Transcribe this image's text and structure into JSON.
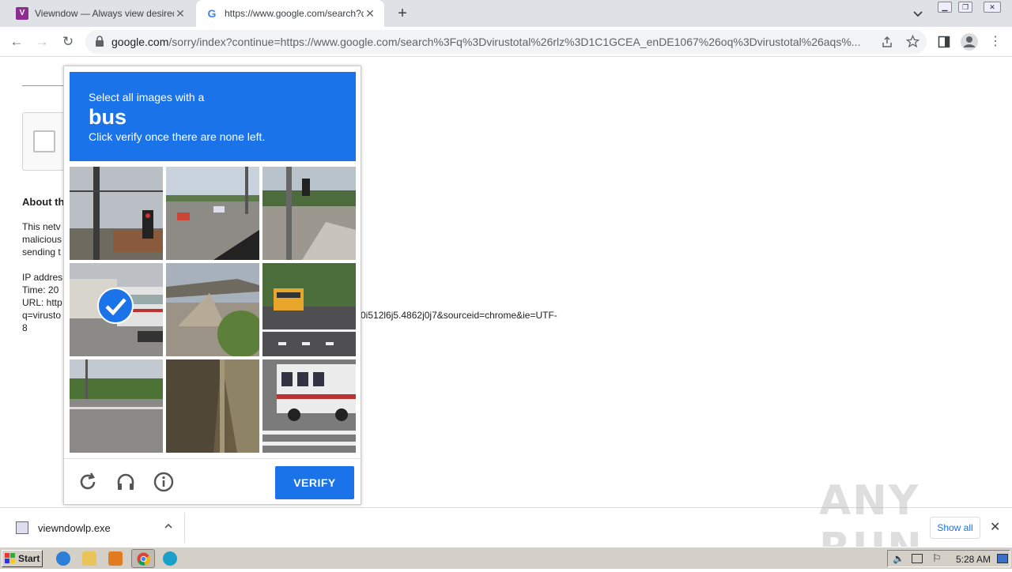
{
  "tabs": [
    {
      "title": "Viewndow — Always view desired wi",
      "favicon": "viewndow-favicon-icon"
    },
    {
      "title": "https://www.google.com/search?q=",
      "favicon": "google-favicon-icon"
    }
  ],
  "toolbar": {
    "url_host": "google.com",
    "url_rest": "/sorry/index?continue=https://www.google.com/search%3Fq%3Dvirustotal%26rlz%3D1C1GCEA_enDE1067%26oq%3Dvirustotal%26aqs%..."
  },
  "page": {
    "about_heading": "About th",
    "para_line1": "This netv",
    "para_line2": "malicious",
    "para_line3": "sending t",
    "ip_label": "IP addres",
    "time_label": "Time: 20",
    "url_label": "URL: http",
    "query_label": "q=virusto",
    "query_tail": "0i512l6j5.4862j0j7&sourceid=chrome&ie=UTF-",
    "query_end": "8"
  },
  "captcha": {
    "instruction": "Select all images with a",
    "target_word": "bus",
    "hint": "Click verify once there are none left.",
    "verify_label": "VERIFY",
    "tiles_selected": [
      false,
      false,
      false,
      true,
      false,
      false,
      false,
      false,
      false
    ]
  },
  "downloads": {
    "filename": "viewndowlp.exe",
    "show_all": "Show all"
  },
  "watermark": "ANY RUN",
  "taskbar": {
    "start_label": "Start",
    "clock": "5:28 AM"
  }
}
